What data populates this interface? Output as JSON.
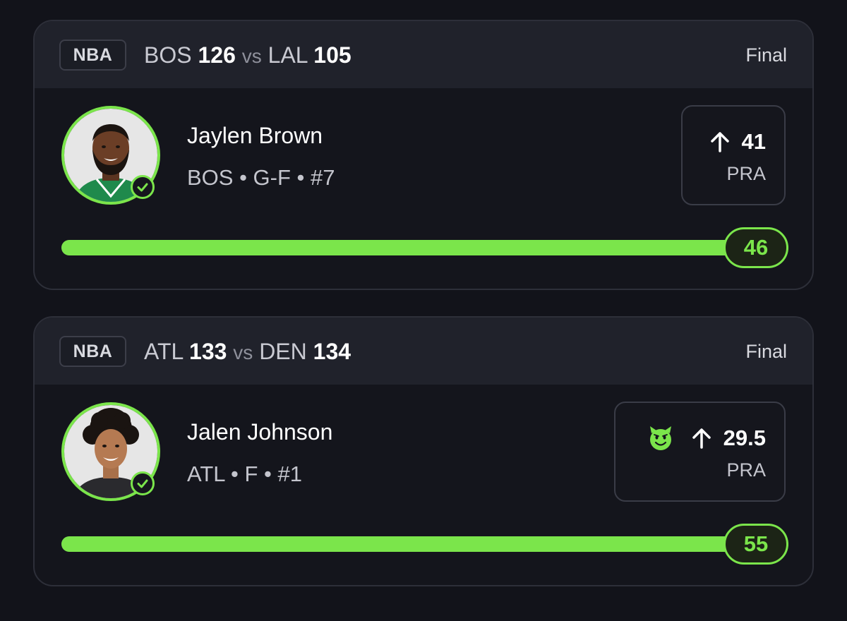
{
  "colors": {
    "accent_green": "#7be54b",
    "background": "#12131a",
    "card_header": "#20222b"
  },
  "cards": [
    {
      "league": "NBA",
      "home_team": "BOS",
      "home_score": "126",
      "vs": "vs",
      "away_team": "LAL",
      "away_score": "105",
      "status": "Final",
      "player": {
        "name": "Jaylen Brown",
        "meta": "BOS • G-F • #7",
        "avatar_icon": "player-headshot",
        "verified_icon": "check-circle-icon"
      },
      "pick": {
        "direction_icon": "arrow-up-icon",
        "line": "41",
        "stat": "PRA",
        "badge_icon": null
      },
      "result": {
        "value": "46",
        "progress_fraction": 1.0
      }
    },
    {
      "league": "NBA",
      "home_team": "ATL",
      "home_score": "133",
      "vs": "vs",
      "away_team": "DEN",
      "away_score": "134",
      "status": "Final",
      "player": {
        "name": "Jalen Johnson",
        "meta": "ATL • F • #1",
        "avatar_icon": "player-headshot",
        "verified_icon": "check-circle-icon"
      },
      "pick": {
        "direction_icon": "arrow-up-icon",
        "line": "29.5",
        "stat": "PRA",
        "badge_icon": "green-devil-emoji-icon"
      },
      "result": {
        "value": "55",
        "progress_fraction": 1.0
      }
    }
  ]
}
